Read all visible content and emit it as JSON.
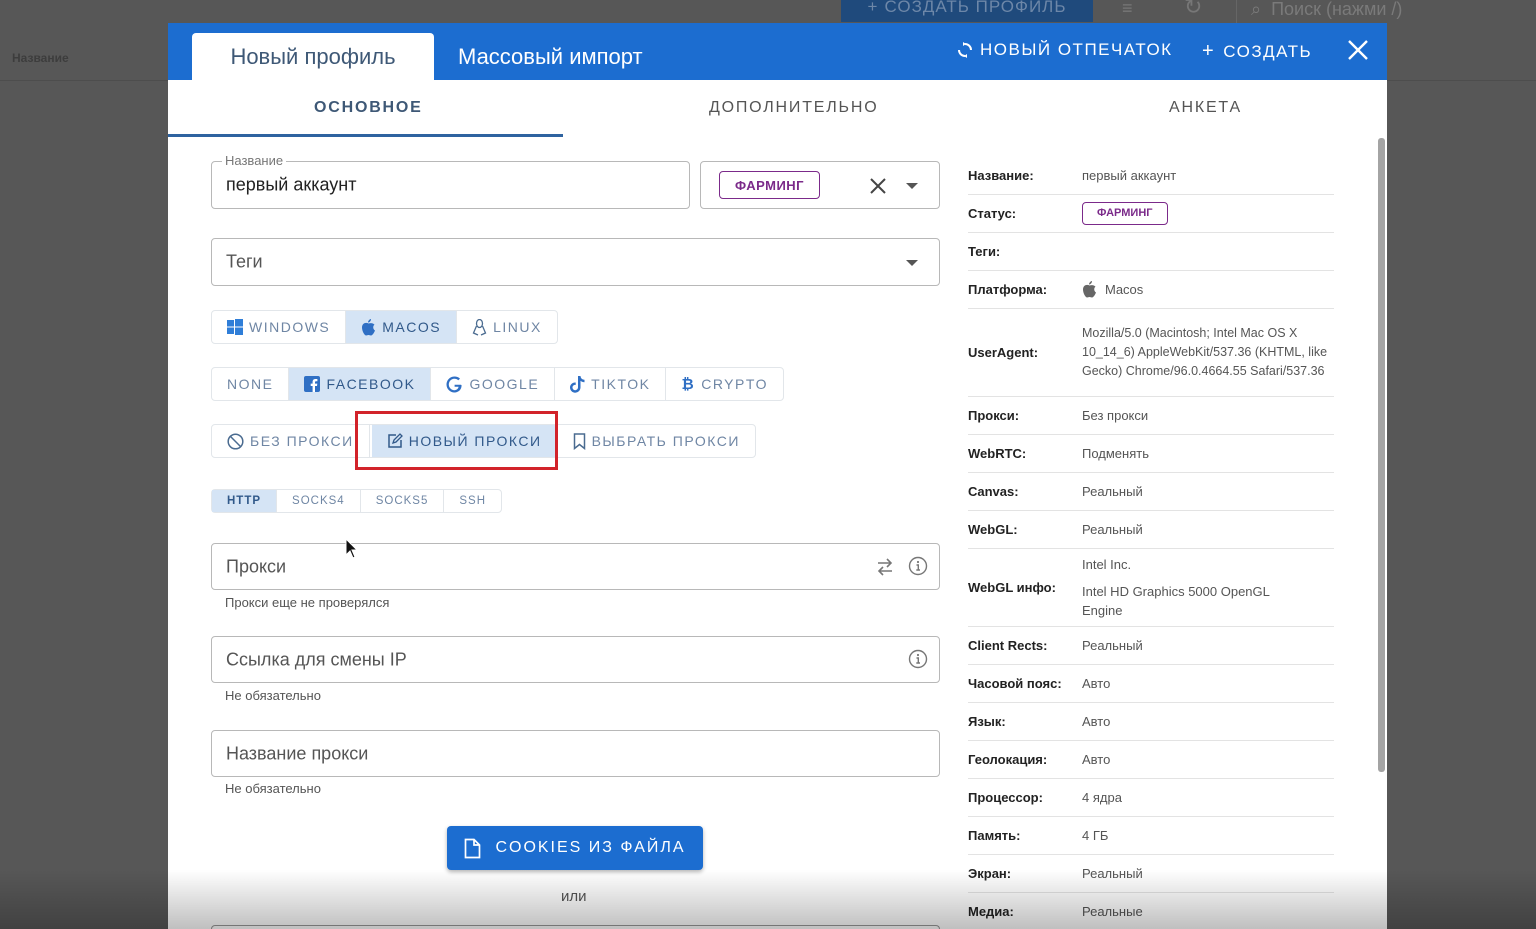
{
  "background": {
    "create_profile_label": "СОЗДАТЬ ПРОФИЛЬ",
    "search_placeholder": "Поиск (нажми /)",
    "column_name": "Название"
  },
  "modal": {
    "tabs": [
      {
        "label": "Новый профиль",
        "active": true
      },
      {
        "label": "Массовый импорт",
        "active": false
      }
    ],
    "new_fingerprint_label": "НОВЫЙ ОТПЕЧАТОК",
    "create_label": "СОЗДАТЬ",
    "subtabs": [
      {
        "label": "ОСНОВНОЕ",
        "active": true
      },
      {
        "label": "ДОПОЛНИТЕЛЬНО",
        "active": false
      },
      {
        "label": "АНКЕТА",
        "active": false
      }
    ]
  },
  "form": {
    "name_label": "Название",
    "name_value": "первый аккаунт",
    "status_value": "ФАРМИНГ",
    "tags_placeholder": "Теги",
    "os_options": [
      {
        "label": "WINDOWS",
        "icon": "windows-icon",
        "selected": false
      },
      {
        "label": "MACOS",
        "icon": "apple-icon",
        "selected": true
      },
      {
        "label": "LINUX",
        "icon": "linux-icon",
        "selected": false
      }
    ],
    "platform_options": [
      {
        "label": "NONE",
        "icon": "",
        "selected": false
      },
      {
        "label": "FACEBOOK",
        "icon": "facebook-icon",
        "selected": true
      },
      {
        "label": "GOOGLE",
        "icon": "google-icon",
        "selected": false
      },
      {
        "label": "TIKTOK",
        "icon": "tiktok-icon",
        "selected": false
      },
      {
        "label": "CRYPTO",
        "icon": "bitcoin-icon",
        "selected": false
      }
    ],
    "proxy_mode_options": [
      {
        "label": "БЕЗ ПРОКСИ",
        "icon": "ban-icon",
        "selected": false
      },
      {
        "label": "НОВЫЙ ПРОКСИ",
        "icon": "edit-icon",
        "selected": true
      },
      {
        "label": "ВЫБРАТЬ ПРОКСИ",
        "icon": "bookmark-icon",
        "selected": false
      }
    ],
    "proxy_type_options": [
      {
        "label": "HTTP",
        "selected": true
      },
      {
        "label": "SOCKS4",
        "selected": false
      },
      {
        "label": "SOCKS5",
        "selected": false
      },
      {
        "label": "SSH",
        "selected": false
      }
    ],
    "proxy_placeholder": "Прокси",
    "proxy_helper": "Прокси еще не проверялся",
    "ip_change_placeholder": "Ссылка для смены IP",
    "ip_change_helper": "Не обязательно",
    "proxy_name_placeholder": "Название прокси",
    "proxy_name_helper": "Не обязательно",
    "cookies_button": "COOKIES ИЗ ФАЙЛА",
    "or_text": "или"
  },
  "summary": {
    "rows": [
      {
        "key": "Название:",
        "value": "первый аккаунт"
      },
      {
        "key": "Статус:",
        "value": "ФАРМИНГ"
      },
      {
        "key": "Теги:",
        "value": ""
      },
      {
        "key": "Платформа:",
        "value": "Macos"
      },
      {
        "key": "UserAgent:",
        "value": "Mozilla/5.0 (Macintosh; Intel Mac OS X 10_14_6) AppleWebKit/537.36 (KHTML, like Gecko) Chrome/96.0.4664.55 Safari/537.36"
      },
      {
        "key": "Прокси:",
        "value": "Без прокси"
      },
      {
        "key": "WebRTC:",
        "value": "Подменять"
      },
      {
        "key": "Canvas:",
        "value": "Реальный"
      },
      {
        "key": "WebGL:",
        "value": "Реальный"
      },
      {
        "key": "WebGL инфо:",
        "value": "Intel Inc.",
        "value2": "Intel HD Graphics 5000 OpenGL Engine"
      },
      {
        "key": "Client Rects:",
        "value": "Реальный"
      },
      {
        "key": "Часовой пояс:",
        "value": "Авто"
      },
      {
        "key": "Язык:",
        "value": "Авто"
      },
      {
        "key": "Геолокация:",
        "value": "Авто"
      },
      {
        "key": "Процессор:",
        "value": "4 ядра"
      },
      {
        "key": "Память:",
        "value": "4 ГБ"
      },
      {
        "key": "Экран:",
        "value": "Реальный"
      },
      {
        "key": "Медиа:",
        "value": "Реальные"
      }
    ]
  },
  "colors": {
    "primary": "#1c6dd0",
    "status_chip": "#7b2a8a",
    "highlight": "#d2232a",
    "selected_option_bg": "#d5e4f5"
  }
}
